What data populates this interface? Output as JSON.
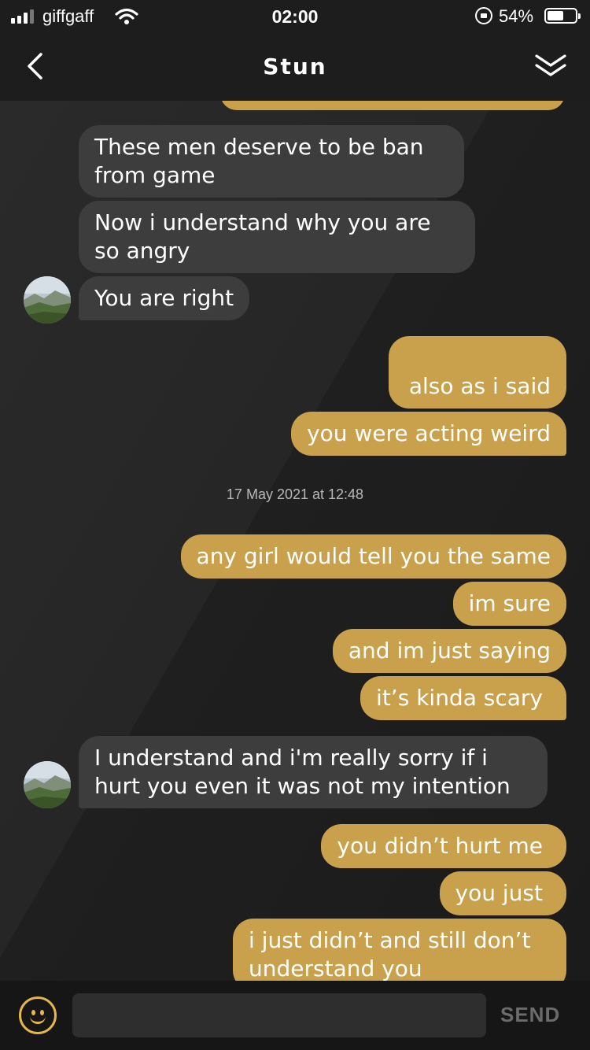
{
  "status_bar": {
    "carrier": "giffgaff",
    "time": "02:00",
    "battery_percent": "54%"
  },
  "header": {
    "title": "Stun",
    "back_icon": "chevron-left-icon",
    "collapse_icon": "double-chevron-down-icon"
  },
  "colors": {
    "outgoing_bubble": "#c9a04b",
    "incoming_bubble": "#3d3d3d",
    "accent": "#e5b64a"
  },
  "messages": [
    {
      "direction": "in",
      "text": "These men deserve to be ban from game"
    },
    {
      "direction": "in",
      "text": "Now i understand why you are so angry"
    },
    {
      "direction": "in",
      "text": "You are right"
    },
    {
      "direction": "out",
      "text": "also as i said"
    },
    {
      "direction": "out",
      "text": "you were acting weird"
    },
    {
      "direction": "out",
      "text": "any girl would tell you the same"
    },
    {
      "direction": "out",
      "text": "im sure"
    },
    {
      "direction": "out",
      "text": "and im just saying"
    },
    {
      "direction": "out",
      "text": "it’s kinda scary"
    },
    {
      "direction": "in",
      "text": "I understand and i'm really sorry if i hurt you even it was not my intention"
    },
    {
      "direction": "out",
      "text": "you didn’t hurt me"
    },
    {
      "direction": "out",
      "text": "you just"
    },
    {
      "direction": "out",
      "text": "i just didn’t and still don’t understand you"
    }
  ],
  "timestamp": "17 May 2021 at 12:48",
  "composer": {
    "input_value": "",
    "send_label": "SEND",
    "emoji_icon": "smiley-icon"
  }
}
